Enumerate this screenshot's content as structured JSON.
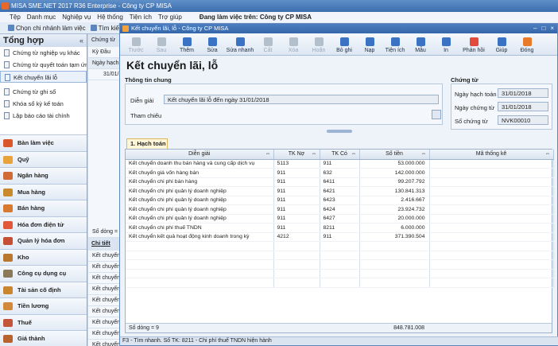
{
  "app": {
    "title": "MISA SME.NET 2017 R36 Enterprise - Công ty CP MISA"
  },
  "menu": {
    "items": [
      "Tệp",
      "Danh mục",
      "Nghiệp vụ",
      "Hệ thống",
      "Tiện ích",
      "Trợ giúp"
    ],
    "working_label": "Đang làm việc trên: Công ty CP MISA"
  },
  "main_toolbar": {
    "branch": "Chọn chi nhánh làm việc",
    "search": "Tìm kiế"
  },
  "sidebar": {
    "header": "Tổng hợp",
    "collapse": "«",
    "items": [
      "Chứng từ nghiệp vụ khác",
      "Chứng từ quyết toán tạm ứn...",
      "Kết chuyển lãi lỗ",
      "Chứng từ ghi sổ",
      "Khóa sổ kỳ kế toán",
      "Lập báo cáo tài chính"
    ],
    "modules": [
      "Bàn làm việc",
      "Quỹ",
      "Ngân hàng",
      "Mua hàng",
      "Bán hàng",
      "Hóa đơn điện tử",
      "Quản lý hóa đơn",
      "Kho",
      "Công cụ dụng cụ",
      "Tài sản cố định",
      "Tiền lương",
      "Thuế",
      "Giá thành"
    ]
  },
  "midstrip": {
    "tab": "Chứng từ",
    "filter_label": "Kỳ",
    "filter_value": "Đầu",
    "col_header": "Ngày hạch",
    "row_date": "31/01/2",
    "row_count": "Số dòng = 0",
    "detail_tab": "Chi tiết",
    "detail_rows": [
      "Kết chuyển",
      "Kết chuyển",
      "Kết chuyển",
      "Kết chuyển",
      "Kết chuyển",
      "Kết chuyển",
      "Kết chuyển",
      "Kết chuyển",
      "Kết chuyển"
    ]
  },
  "dialog": {
    "title": "Kết chuyển lãi, lỗ - Công ty CP MISA",
    "win_buttons": [
      "–",
      "□",
      "×"
    ],
    "toolbar": [
      {
        "label": "Trước",
        "enabled": false,
        "color": "#9aa7b8"
      },
      {
        "label": "Sau",
        "enabled": false,
        "color": "#9aa7b8"
      },
      {
        "label": "Thêm",
        "enabled": true,
        "color": "#3a73c4"
      },
      {
        "label": "Sửa",
        "enabled": true,
        "color": "#3a73c4"
      },
      {
        "label": "Sửa nhanh",
        "enabled": true,
        "color": "#3a73c4"
      },
      {
        "label": "Cất",
        "enabled": false,
        "color": "#9aa7b8"
      },
      {
        "label": "Xóa",
        "enabled": false,
        "color": "#9aa7b8"
      },
      {
        "label": "Hoãn",
        "enabled": false,
        "color": "#9aa7b8"
      },
      {
        "label": "Bỏ ghi",
        "enabled": true,
        "color": "#3a73c4"
      },
      {
        "label": "Nạp",
        "enabled": true,
        "color": "#3a73c4"
      },
      {
        "label": "Tiện ích",
        "enabled": true,
        "color": "#3a73c4"
      },
      {
        "label": "Mẫu",
        "enabled": true,
        "color": "#3a73c4"
      },
      {
        "label": "In",
        "enabled": true,
        "color": "#3a73c4"
      },
      {
        "label": "Phản hồi",
        "enabled": true,
        "color": "#e24a3b"
      },
      {
        "label": "Giúp",
        "enabled": true,
        "color": "#3a73c4"
      },
      {
        "label": "Đóng",
        "enabled": true,
        "color": "#e87a2a"
      }
    ],
    "heading": "Kết chuyển lãi, lỗ",
    "general": {
      "title": "Thông tin chung",
      "desc_label": "Diễn giải",
      "desc_value": "Kết chuyển lãi lỗ đến ngày 31/01/2018",
      "ref_label": "Tham chiếu"
    },
    "voucher": {
      "title": "Chứng từ",
      "post_date_label": "Ngày hạch toán",
      "post_date": "31/01/2018",
      "doc_date_label": "Ngày chứng từ",
      "doc_date": "31/01/2018",
      "doc_no_label": "Số chứng từ",
      "doc_no": "NVK00010"
    },
    "grid_tab": "1. Hạch toán",
    "grid": {
      "columns": [
        "Diễn giải",
        "TK Nợ",
        "TK Có",
        "Số tiền",
        "Mã thống kê"
      ],
      "rows": [
        [
          "Kết chuyển doanh thu bán hàng và cung cấp dịch vụ",
          "5113",
          "911",
          "53.000.000",
          ""
        ],
        [
          "Kết chuyển giá vốn hàng bán",
          "911",
          "632",
          "142.000.000",
          ""
        ],
        [
          "Kết chuyển chi phí bán hàng",
          "911",
          "6411",
          "99.207.792",
          ""
        ],
        [
          "Kết chuyển chi phí quản lý doanh nghiệp",
          "911",
          "6421",
          "130.841.313",
          ""
        ],
        [
          "Kết chuyển chi phí quản lý doanh nghiệp",
          "911",
          "6423",
          "2.416.667",
          ""
        ],
        [
          "Kết chuyển chi phí quản lý doanh nghiệp",
          "911",
          "6424",
          "23.924.732",
          ""
        ],
        [
          "Kết chuyển chi phí quản lý doanh nghiệp",
          "911",
          "6427",
          "20.000.000",
          ""
        ],
        [
          "Kết chuyển chi phí thuế TNDN",
          "911",
          "8211",
          "6.000.000",
          ""
        ],
        [
          "Kết chuyển kết quả hoạt động kinh doanh trong kỳ",
          "4212",
          "911",
          "371.390.504",
          ""
        ]
      ],
      "footer_count": "Số dòng = 9",
      "footer_total": "848.781.008"
    },
    "status": "F3 - Tìm nhanh. Số TK: 8211 - Chi phí thuế TNDN hiện hành"
  },
  "colors": {
    "titlebar": "#3c6eaf",
    "accent": "#3a73c4",
    "tab_active": "#fff6d8"
  }
}
